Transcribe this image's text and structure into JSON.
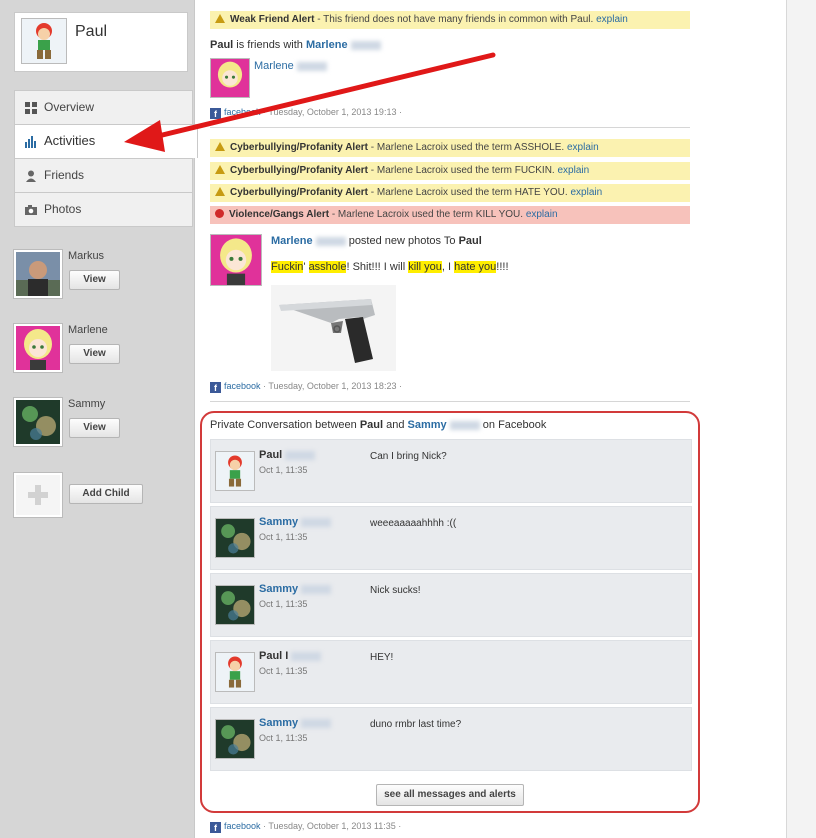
{
  "profile": {
    "name": "Paul"
  },
  "nav": [
    {
      "label": "Overview",
      "icon": "grid-icon",
      "active": false
    },
    {
      "label": "Activities",
      "icon": "bar-chart-icon",
      "active": true
    },
    {
      "label": "Friends",
      "icon": "person-icon",
      "active": false
    },
    {
      "label": "Photos",
      "icon": "camera-icon",
      "active": false
    }
  ],
  "children": [
    {
      "name": "Markus",
      "button": "View"
    },
    {
      "name": "Marlene",
      "button": "View"
    },
    {
      "name": "Sammy",
      "button": "View"
    }
  ],
  "add_child_label": "Add Child",
  "post1": {
    "alert_title": "Weak Friend Alert",
    "alert_text": " - This friend does not have many friends in common with Paul. ",
    "alert_link": "explain",
    "subject": "Paul",
    "verb": " is friends with ",
    "friend": "Marlene",
    "friend_tag": "Marlene",
    "source": "facebook",
    "timestamp": " · Tuesday, October 1, 2013 19:13 ·"
  },
  "post2": {
    "alerts": [
      {
        "title": "Cyberbullying/Profanity Alert",
        "text": " - Marlene Lacroix used the term ASSHOLE. ",
        "link": "explain"
      },
      {
        "title": "Cyberbullying/Profanity Alert",
        "text": " - Marlene Lacroix used the term FUCKIN. ",
        "link": "explain"
      },
      {
        "title": "Cyberbullying/Profanity Alert",
        "text": " - Marlene Lacroix used the term HATE YOU. ",
        "link": "explain"
      }
    ],
    "violence_alert": {
      "title": "Violence/Gangs Alert",
      "text": " - Marlene Lacroix used the term KILL YOU. ",
      "link": "explain"
    },
    "author": "Marlene",
    "action": " posted new photos To ",
    "target": "Paul",
    "msg": {
      "w1": "Fuckin",
      "t1": "' ",
      "w2": "asshole",
      "t2": "! Shit!!! I will ",
      "w3": "kill you",
      "t3": ", I ",
      "w4": "hate you",
      "t4": "!!!!"
    },
    "source": "facebook",
    "timestamp": " · Tuesday, October 1, 2013 18:23 ·"
  },
  "conversation": {
    "title_pre": "Private Conversation between ",
    "p1": "Paul",
    "and": " and ",
    "p2": "Sammy",
    "title_post": " on Facebook",
    "messages": [
      {
        "name": "Paul",
        "time": "Oct 1, 11:35",
        "text": "Can I bring Nick?"
      },
      {
        "name": "Sammy",
        "time": "Oct 1, 11:35",
        "text": "weeeaaaaahhhh :(("
      },
      {
        "name": "Sammy",
        "time": "Oct 1, 11:35",
        "text": "Nick sucks!"
      },
      {
        "name": "Paul I",
        "time": "Oct 1, 11:35",
        "text": "HEY!"
      },
      {
        "name": "Sammy",
        "time": "Oct 1, 11:35",
        "text": "duno rmbr last time?"
      }
    ],
    "see_all": "see all messages and alerts",
    "source": "facebook",
    "timestamp": " · Tuesday, October 1, 2013 11:35 ·"
  },
  "colors": {
    "alert_yellow": "#fbf2b0",
    "alert_red": "#f7c2bb",
    "link": "#2b6ca3",
    "highlight": "#ffee00",
    "annotation_red": "#e01818"
  }
}
